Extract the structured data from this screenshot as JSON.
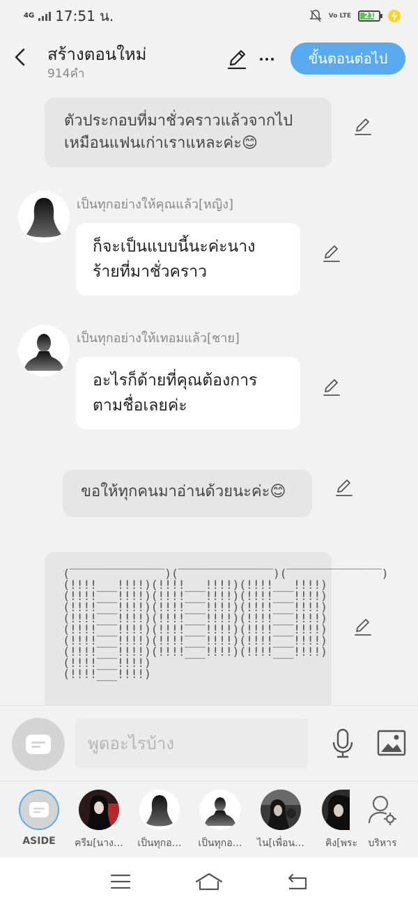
{
  "status_bar": {
    "network": "4G",
    "time": "17:51 น.",
    "volte": "Vo LTE",
    "battery": "21"
  },
  "header": {
    "title": "สร้างตอนใหม่",
    "subtitle": "914คำ",
    "next_button": "ขั้นตอนต่อไป"
  },
  "messages": {
    "narration_1_line1": "ตัวประกอบที่มาชั่วคราวแล้วจากไป",
    "narration_1_line2": "เหมือนแฟนเก่าเราแหละค่ะ😊",
    "speaker_1": "เป็นทุกอย่างให้คุณแล้ว[หญิง]",
    "bubble_1_line1": "ก็จะเป็นแบบนี้นะค่ะนาง",
    "bubble_1_line2": "ร้ายที่มาชั่วคราว",
    "speaker_2": "เป็นทุกอย่างให้เทอมแล้ว[ชาย]",
    "bubble_2_line1": "อะไรก็ด้ายที่คุณต้องการ",
    "bubble_2_line2": "ตามชื่อเลยค่ะ",
    "narration_2": "ขอให้ทุกคนมาอ่านด้วยนะค่ะ😊",
    "ascii_art": "(‾‾‾‾‾‾‾‾‾‾‾‾‾‾)(‾‾‾‾‾‾‾‾‾‾‾‾‾‾)(‾‾‾‾‾‾‾‾‾‾‾‾‾‾)\n(!!!!___!!!!)(!!!!___!!!!)(!!!!___!!!!)\n(!!!!___!!!!)(!!!!___!!!!)(!!!!___!!!!)\n(!!!!___!!!!)(!!!!___!!!!)(!!!!___!!!!)\n(!!!!___!!!!)(!!!!___!!!!)(!!!!___!!!!)\n(!!!!___!!!!)(!!!!___!!!!)(!!!!___!!!!)\n(!!!!___!!!!)(!!!!___!!!!)(!!!!___!!!!)\n(!!!!___!!!!)(!!!!___!!!!)(!!!!___!!!!)\n(!!!!___!!!!)\n(!!!!___!!!!)"
  },
  "input": {
    "placeholder": "พูดอะไรบ้าง"
  },
  "characters": [
    {
      "label": "ASIDE"
    },
    {
      "label": "ครีม[นาง…"
    },
    {
      "label": "เป็นทุกอ…"
    },
    {
      "label": "เป็นทุกอ…"
    },
    {
      "label": "ไน[เพื่อน…"
    },
    {
      "label": "คิง[พระ"
    },
    {
      "label": "บริหาร"
    }
  ],
  "colors": {
    "accent": "#5aaaf0",
    "background": "#f2f2f2",
    "narration_bg": "#e6e6e6",
    "bubble_bg": "#ffffff"
  }
}
